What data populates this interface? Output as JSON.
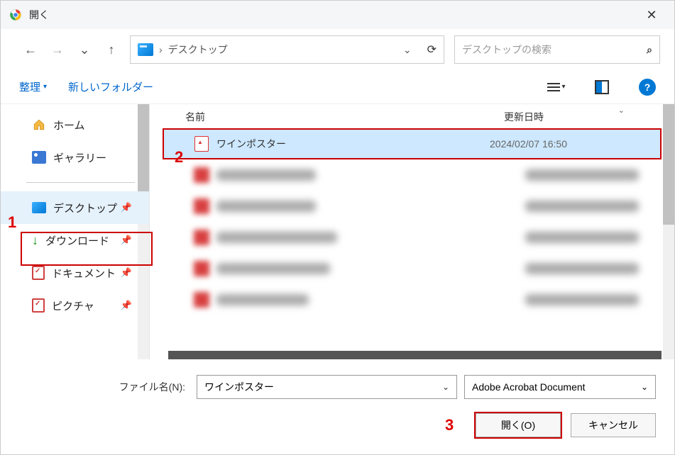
{
  "window": {
    "title": "開く"
  },
  "nav": {
    "location": "デスクトップ",
    "search_placeholder": "デスクトップの検索"
  },
  "toolbar": {
    "organize": "整理",
    "new_folder": "新しいフォルダー"
  },
  "sidebar": {
    "home": "ホーム",
    "gallery": "ギャラリー",
    "desktop": "デスクトップ",
    "downloads": "ダウンロード",
    "documents": "ドキュメント",
    "pictures": "ピクチャ"
  },
  "columns": {
    "name": "名前",
    "modified": "更新日時"
  },
  "files": {
    "selected": {
      "name": "ワインポスター",
      "date": "2024/02/07 16:50"
    }
  },
  "footer": {
    "filename_label": "ファイル名(N):",
    "filename_value": "ワインポスター",
    "filetype": "Adobe Acrobat Document",
    "open": "開く(O)",
    "cancel": "キャンセル"
  },
  "annotations": {
    "a1": "1",
    "a2": "2",
    "a3": "3"
  }
}
